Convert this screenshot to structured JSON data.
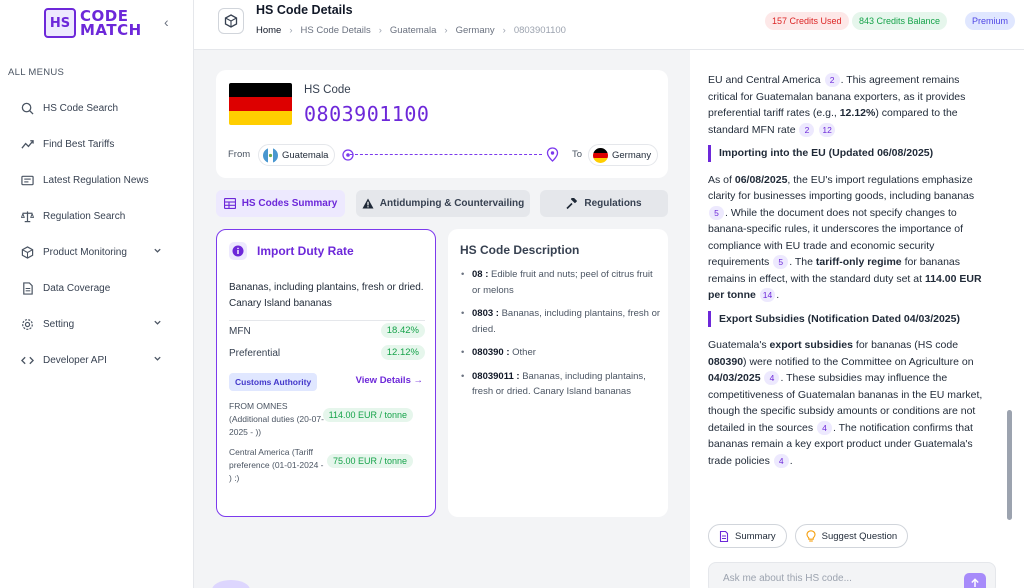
{
  "sidebar": {
    "logo_mark": "HS",
    "logo_line1": "CODE",
    "logo_line2": "MATCH",
    "menu_title": "ALL MENUS",
    "items": [
      {
        "label": "HS Code Search",
        "icon": "search-icon"
      },
      {
        "label": "Find Best Tariffs",
        "icon": "trend-icon"
      },
      {
        "label": "Latest Regulation News",
        "icon": "newspaper-icon"
      },
      {
        "label": "Regulation Search",
        "icon": "scale-icon"
      },
      {
        "label": "Product Monitoring",
        "icon": "box-icon"
      },
      {
        "label": "Data Coverage",
        "icon": "document-icon"
      },
      {
        "label": "Setting",
        "icon": "gear-icon"
      },
      {
        "label": "Developer API",
        "icon": "code-icon"
      }
    ]
  },
  "header": {
    "title": "HS Code Details",
    "breadcrumb": [
      "Home",
      "HS Code Details",
      "Guatemala",
      "Germany",
      "0803901100"
    ],
    "credits_used": "157 Credits Used",
    "credits_balance": "843 Credits Balance",
    "plan": "Premium"
  },
  "hs": {
    "label": "HS Code",
    "code": "0803901100",
    "from_label": "From",
    "from_country": "Guatemala",
    "to_label": "To",
    "to_country": "Germany"
  },
  "tabs": [
    "HS Codes Summary",
    "Antidumping & Countervailing",
    "Regulations"
  ],
  "duty": {
    "title": "Import Duty Rate",
    "description": "Bananas, including plantains, fresh or dried. Canary Island bananas",
    "mfn_label": "MFN",
    "mfn_value": "18.42%",
    "pref_label": "Preferential",
    "pref_value": "12.12%",
    "authority": "Customs Authority",
    "view_details": "View Details →",
    "extra": [
      {
        "text": "FROM OMNES (Additional duties (20-07-2025 - ))",
        "value": "114.00 EUR / tonne"
      },
      {
        "text": "Central America (Tariff preference (01-01-2024 - ) :)",
        "value": "75.00 EUR / tonne"
      }
    ]
  },
  "description": {
    "title": "HS Code Description",
    "items": [
      {
        "code": "08 :",
        "text": "Edible fruit and nuts; peel of citrus fruit or melons"
      },
      {
        "code": "0803 :",
        "text": "Bananas, including plantains, fresh or dried."
      },
      {
        "code": "080390 :",
        "text": "Other"
      },
      {
        "code": "08039011 :",
        "text": "Bananas, including plantains, fresh or dried. Canary Island bananas"
      }
    ]
  },
  "chat": {
    "p1_a": "EU and Central America",
    "p1_c1": "2",
    "p1_b": ". This agreement remains critical for Guatemalan banana exporters, as it provides preferential tariff rates (e.g.,",
    "p1_bold": "12.12%",
    "p1_c": ") compared to the standard MFN rate",
    "p1_c2": "2",
    "p1_c3": "12",
    "h1": "Importing into the EU (Updated 06/08/2025)",
    "p2_a": "As of",
    "p2_bold1": "06/08/2025",
    "p2_b": ", the EU's import regulations emphasize clarity for businesses importing goods, including bananas",
    "p2_c1": "5",
    "p2_c": ". While the document does not specify changes to banana-specific rules, it underscores the importance of compliance with EU trade and economic security requirements",
    "p2_c2": "5",
    "p2_d": ". The",
    "p2_bold2": "tariff-only regime",
    "p2_e": "for bananas remains in effect, with the standard duty set at",
    "p2_bold3": "114.00 EUR per tonne",
    "p2_c3": "14",
    "h2": "Export Subsidies (Notification Dated 04/03/2025)",
    "p3_a": "Guatemala's",
    "p3_bold1": "export subsidies",
    "p3_b": "for bananas (HS code",
    "p3_bold2": "080390",
    "p3_c": ") were notified to the Committee on Agriculture on",
    "p3_bold3": "04/03/2025",
    "p3_c1": "4",
    "p3_d": ". These subsidies may influence the competitiveness of Guatemalan bananas in the EU market, though the specific subsidy amounts or conditions are not detailed in the sources",
    "p3_c2": "4",
    "p3_e": ". The notification confirms that bananas remain a key export product under Guatemala's trade policies",
    "p3_c3": "4",
    "summary_btn": "Summary",
    "suggest_btn": "Suggest Question",
    "input_placeholder": "Ask me about this HS code..."
  },
  "colors": {
    "accent": "#6d28d9",
    "success": "#16a34a",
    "danger": "#dc2626"
  }
}
